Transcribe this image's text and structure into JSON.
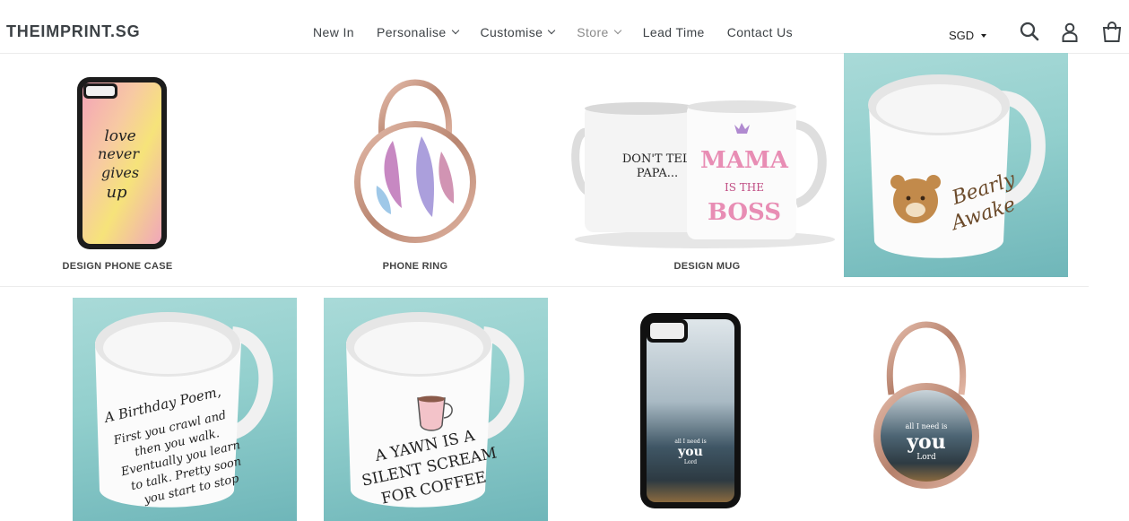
{
  "header": {
    "logo": "THEIMPRINT.SG",
    "nav": [
      {
        "label": "New In",
        "has_dropdown": false,
        "muted": false
      },
      {
        "label": "Personalise",
        "has_dropdown": true,
        "muted": false
      },
      {
        "label": "Customise",
        "has_dropdown": true,
        "muted": false
      },
      {
        "label": "Store",
        "has_dropdown": true,
        "muted": true
      },
      {
        "label": "Lead Time",
        "has_dropdown": false,
        "muted": false
      },
      {
        "label": "Contact Us",
        "has_dropdown": false,
        "muted": false
      }
    ],
    "currency": "SGD",
    "icons": [
      "search-icon",
      "account-icon",
      "cart-icon"
    ]
  },
  "products_row1": [
    {
      "title": "DESIGN PHONE CASE",
      "art_text": [
        "love",
        "never",
        "gives",
        "up"
      ]
    },
    {
      "title": "PHONE RING"
    },
    {
      "title": "DESIGN MUG",
      "art_text_left": [
        "DON'T TELL",
        "PAPA..."
      ],
      "art_text_right": [
        "MAMA",
        "IS THE",
        "BOSS"
      ]
    },
    {
      "title": "",
      "art_text": [
        "Bearly",
        "Awake"
      ]
    }
  ],
  "products_row2": [
    {
      "art_text": [
        "A Birthday Poem,",
        "First you crawl and",
        "then you walk.",
        "Eventually you learn",
        "to talk. Pretty soon",
        "you start to stop"
      ]
    },
    {
      "art_text": [
        "A YAWN IS A",
        "SILENT SCREAM",
        "FOR COFFEE"
      ]
    },
    {
      "art_text": [
        "all I need is",
        "you",
        "Lord"
      ]
    },
    {
      "art_text": [
        "all I need is",
        "you",
        "Lord"
      ]
    }
  ],
  "colors": {
    "text": "#3d4246",
    "teal_bg": "#92cfcd",
    "rose_gold": "#c99a85"
  }
}
